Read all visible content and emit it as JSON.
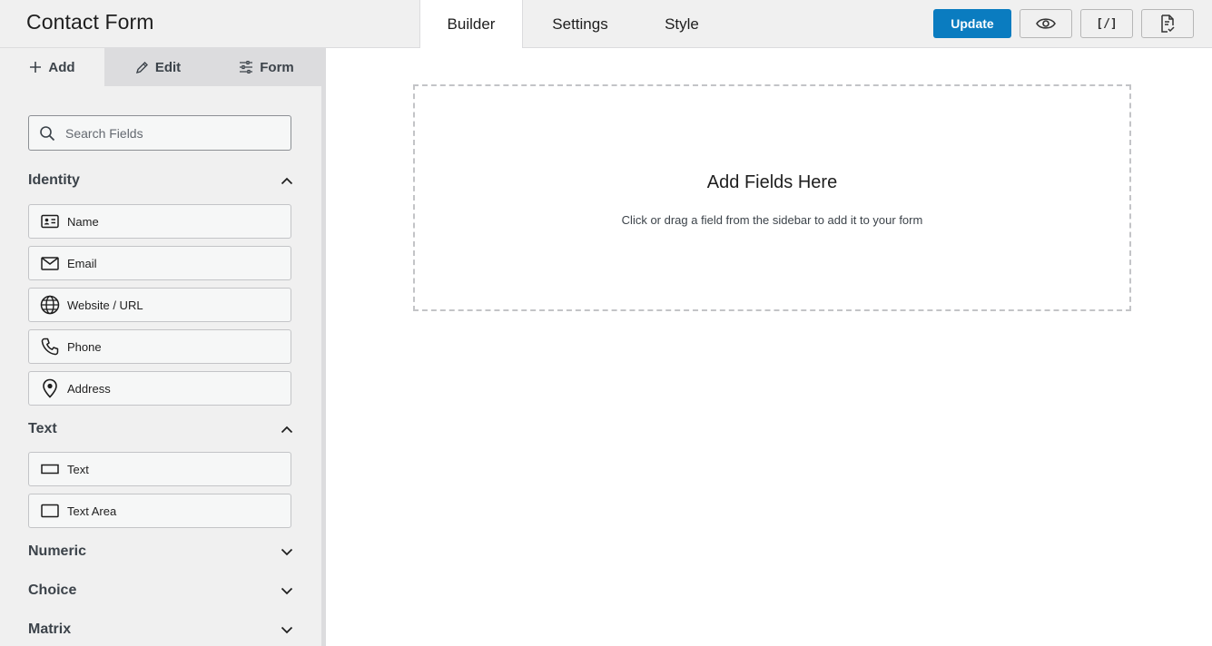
{
  "app": {
    "title": "Contact Form"
  },
  "header": {
    "tabs": [
      {
        "label": "Builder",
        "active": true
      },
      {
        "label": "Settings",
        "active": false
      },
      {
        "label": "Style",
        "active": false
      }
    ],
    "update_label": "Update",
    "preview_icon": "eye-icon",
    "embed_icon_text": "[/]",
    "entries_icon": "document-check-icon"
  },
  "sidebar": {
    "tabs": [
      {
        "label": "Add",
        "icon": "plus-icon"
      },
      {
        "label": "Edit",
        "icon": "pencil-icon"
      },
      {
        "label": "Form",
        "icon": "sliders-icon"
      }
    ],
    "search": {
      "placeholder": "Search Fields",
      "value": ""
    },
    "sections": [
      {
        "label": "Identity",
        "expanded": true,
        "fields": [
          {
            "label": "Name",
            "icon": "id-card-icon"
          },
          {
            "label": "Email",
            "icon": "envelope-icon"
          },
          {
            "label": "Website / URL",
            "icon": "globe-icon"
          },
          {
            "label": "Phone",
            "icon": "phone-icon"
          },
          {
            "label": "Address",
            "icon": "map-pin-icon"
          }
        ]
      },
      {
        "label": "Text",
        "expanded": true,
        "fields": [
          {
            "label": "Text",
            "icon": "text-field-icon"
          },
          {
            "label": "Text Area",
            "icon": "text-area-icon"
          }
        ]
      },
      {
        "label": "Numeric",
        "expanded": false,
        "fields": []
      },
      {
        "label": "Choice",
        "expanded": false,
        "fields": []
      },
      {
        "label": "Matrix",
        "expanded": false,
        "fields": []
      }
    ]
  },
  "canvas": {
    "title": "Add Fields Here",
    "subtitle": "Click or drag a field from the sidebar to add it to your form"
  },
  "colors": {
    "accent": "#0a7cc0",
    "background": "#f0f0f0",
    "canvas": "#ffffff"
  }
}
